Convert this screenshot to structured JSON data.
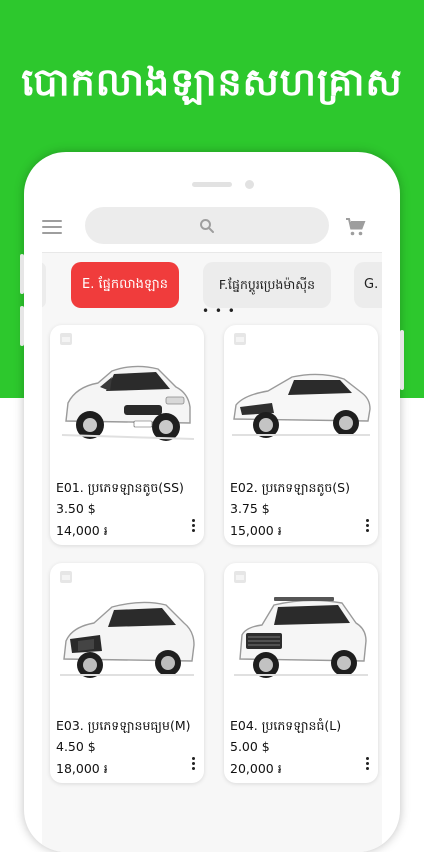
{
  "banner": {
    "headline": "បោកលាងឡានសហគ្រាស"
  },
  "search": {
    "placeholder": ""
  },
  "categories": [
    {
      "label": ""
    },
    {
      "label": "E. ផ្នែកលាងឡាន"
    },
    {
      "label": "F.ផ្នែកប្តូរប្រេងម៉ាស៊ីន"
    },
    {
      "label": "G. ផ្នែ"
    }
  ],
  "products": [
    {
      "title": "E01. ប្រភេទឡានតូច(SS)",
      "price_usd": "3.50 $",
      "price_riel": "14,000 ៛",
      "car": "small hatchback",
      "color": "#f4f4f4"
    },
    {
      "title": "E02. ប្រភេទឡានតូច(S)",
      "price_usd": "3.75 $",
      "price_riel": "15,000 ៛",
      "car": "sedan",
      "color": "#f4f4f4"
    },
    {
      "title": "E03. ប្រភេទឡានមធ្យម(M)",
      "price_usd": "4.50 $",
      "price_riel": "18,000 ៛",
      "car": "crossover suv",
      "color": "#f4f4f4"
    },
    {
      "title": "E04. ប្រភេទឡានធំ(L)",
      "price_usd": "5.00 $",
      "price_riel": "20,000 ៛",
      "car": "large suv",
      "color": "#f4f4f4"
    }
  ],
  "theme": {
    "brand_green": "#2dc82d",
    "active_chip": "#f03c3c"
  }
}
